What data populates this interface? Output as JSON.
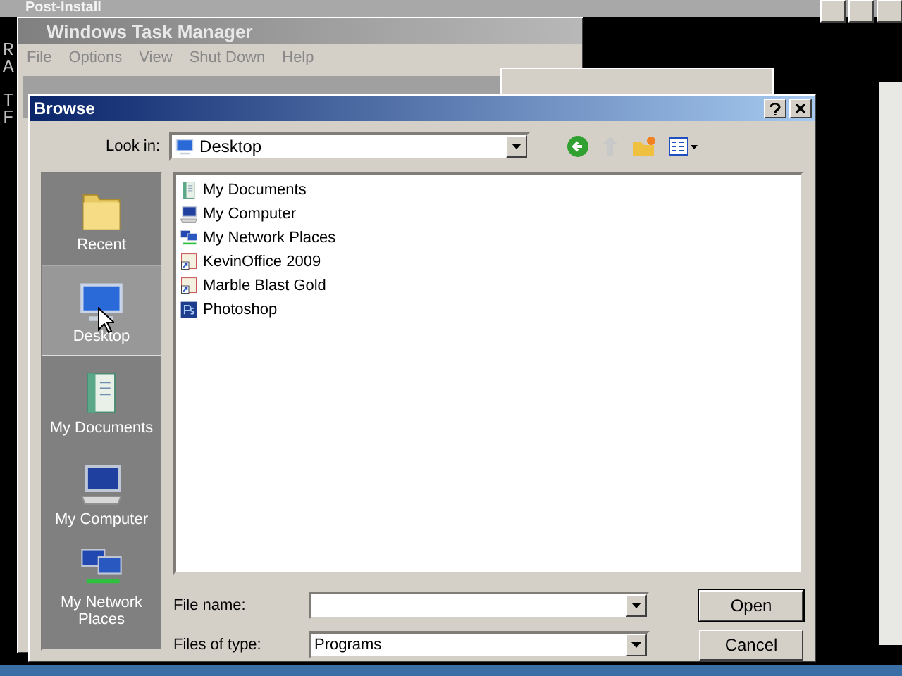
{
  "console_window": {
    "title": "Post-Install",
    "lines": [
      "R",
      "A",
      "T",
      "F"
    ]
  },
  "task_manager": {
    "title": "Windows Task Manager",
    "menu": [
      "File",
      "Options",
      "View",
      "Shut Down",
      "Help"
    ]
  },
  "browse_dialog": {
    "title": "Browse",
    "look_in": {
      "label": "Look in:",
      "value": "Desktop"
    },
    "places": [
      {
        "label": "Recent",
        "selected": false
      },
      {
        "label": "Desktop",
        "selected": true
      },
      {
        "label": "My Documents",
        "selected": false
      },
      {
        "label": "My Computer",
        "selected": false
      },
      {
        "label": "My Network Places",
        "selected": false
      }
    ],
    "files": [
      {
        "name": "My Documents"
      },
      {
        "name": "My Computer"
      },
      {
        "name": "My Network Places"
      },
      {
        "name": "KevinOffice 2009"
      },
      {
        "name": "Marble Blast Gold"
      },
      {
        "name": "Photoshop"
      }
    ],
    "file_name": {
      "label": "File name:"
    },
    "files_of_type": {
      "label": "Files of type:",
      "value": "Programs"
    },
    "buttons": [
      "Open",
      "Cancel"
    ]
  }
}
